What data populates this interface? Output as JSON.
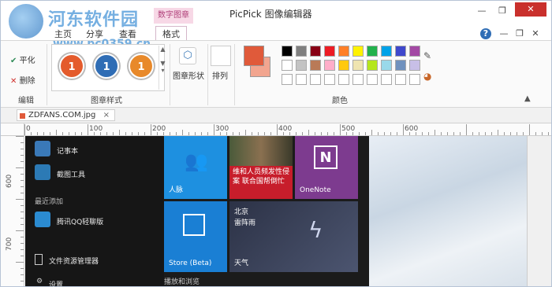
{
  "watermark": {
    "site_name": "河东软件园",
    "url": "www.pc0359.cn"
  },
  "titlebar": {
    "app_title": "PicPick 图像编辑器",
    "context_tab": "数字图章",
    "controls": {
      "minimize": "—",
      "restore": "❐",
      "close": "✕"
    }
  },
  "tabs": {
    "home": "主页",
    "share": "分享",
    "view": "查看",
    "format": "格式"
  },
  "ribbon_right": {
    "help": "?",
    "min": "—",
    "restore": "❐",
    "close": "✕"
  },
  "edit_group": {
    "flatten": "平化",
    "delete": "删除",
    "label": "编辑"
  },
  "stamp_style_group": {
    "label": "图章样式",
    "stamps": [
      {
        "text": "1",
        "color": "#e45b2c"
      },
      {
        "text": "1",
        "color": "#2f6db5"
      },
      {
        "text": "1",
        "color": "#e8892a"
      }
    ]
  },
  "shape_group": {
    "shape_label": "图章形状",
    "arrange_label": "排列"
  },
  "color_group": {
    "label": "颜色",
    "current_fg": "#e05a3a",
    "current_bg": "#ffffff",
    "palette_row1": [
      "#000000",
      "#7f7f7f",
      "#880015",
      "#ed1c24",
      "#ff7f27",
      "#fff200",
      "#22b14c",
      "#00a2e8",
      "#3f48cc",
      "#a349a4"
    ],
    "palette_row2": [
      "#ffffff",
      "#c3c3c3",
      "#b97a57",
      "#ffaec9",
      "#ffc90e",
      "#efe4b0",
      "#b5e61d",
      "#99d9ea",
      "#7092be",
      "#c8bfe7"
    ]
  },
  "document": {
    "tab_name": "ZDFANS.COM.jpg",
    "close": "×"
  },
  "ruler_h": [
    "0",
    "100",
    "200",
    "300",
    "400",
    "500",
    "600"
  ],
  "ruler_v": [
    "600",
    "700"
  ],
  "start_menu": {
    "items": [
      {
        "label": "记事本",
        "color": "#3a79b8"
      },
      {
        "label": "截图工具",
        "color": "#2c7ab5"
      }
    ],
    "recent_header": "最近添加",
    "recent": [
      {
        "label": "腾讯QQ轻聊版",
        "color": "#2b8bd1"
      }
    ],
    "file_explorer": "文件资源管理器",
    "settings": "设置"
  },
  "tiles": {
    "people": "人脉",
    "news_text": "维和人员频发性侵案 联合国帮倒忙",
    "onenote": "OneNote",
    "store": "Store (Beta)",
    "weather_city": "北京",
    "weather_cond": "雷阵雨",
    "weather": "天气",
    "bottom_label": "播放和浏览"
  }
}
